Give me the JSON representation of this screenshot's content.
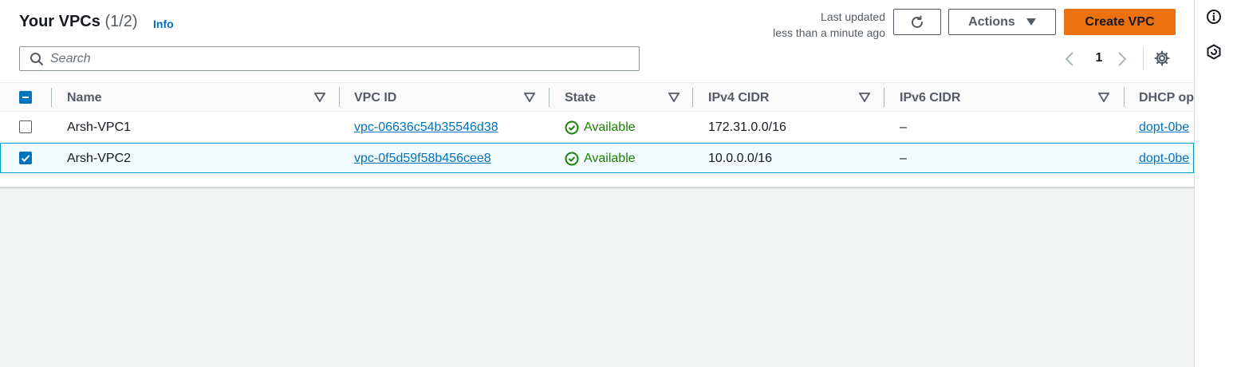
{
  "header": {
    "title": "Your VPCs",
    "count": "(1/2)",
    "info": "Info",
    "last_updated_line1": "Last updated",
    "last_updated_line2": "less than a minute ago",
    "actions_label": "Actions",
    "create_label": "Create VPC"
  },
  "search": {
    "placeholder": "Search",
    "value": ""
  },
  "pagination": {
    "current_page": "1"
  },
  "table": {
    "columns": [
      "Name",
      "VPC ID",
      "State",
      "IPv4 CIDR",
      "IPv6 CIDR",
      "DHCP op"
    ],
    "rows": [
      {
        "name": "Arsh-VPC1",
        "vpc_id": "vpc-06636c54b35546d38",
        "state": "Available",
        "ipv4": "172.31.0.0/16",
        "ipv6": "–",
        "dhcp": "dopt-0be",
        "selected": false
      },
      {
        "name": "Arsh-VPC2",
        "vpc_id": "vpc-0f5d59f58b456cee8",
        "state": "Available",
        "ipv4": "10.0.0.0/16",
        "ipv6": "–",
        "dhcp": "dopt-0be",
        "selected": true
      }
    ]
  },
  "colors": {
    "link": "#0073bb",
    "primary_button": "#ec7211",
    "available": "#1d8102",
    "checkbox": "#0073bb"
  },
  "icons": [
    "refresh-icon",
    "caret-down-icon",
    "search-icon",
    "chevron-left-icon",
    "chevron-right-icon",
    "gear-icon",
    "info-icon",
    "hexagon-icon",
    "check-circle-icon"
  ]
}
